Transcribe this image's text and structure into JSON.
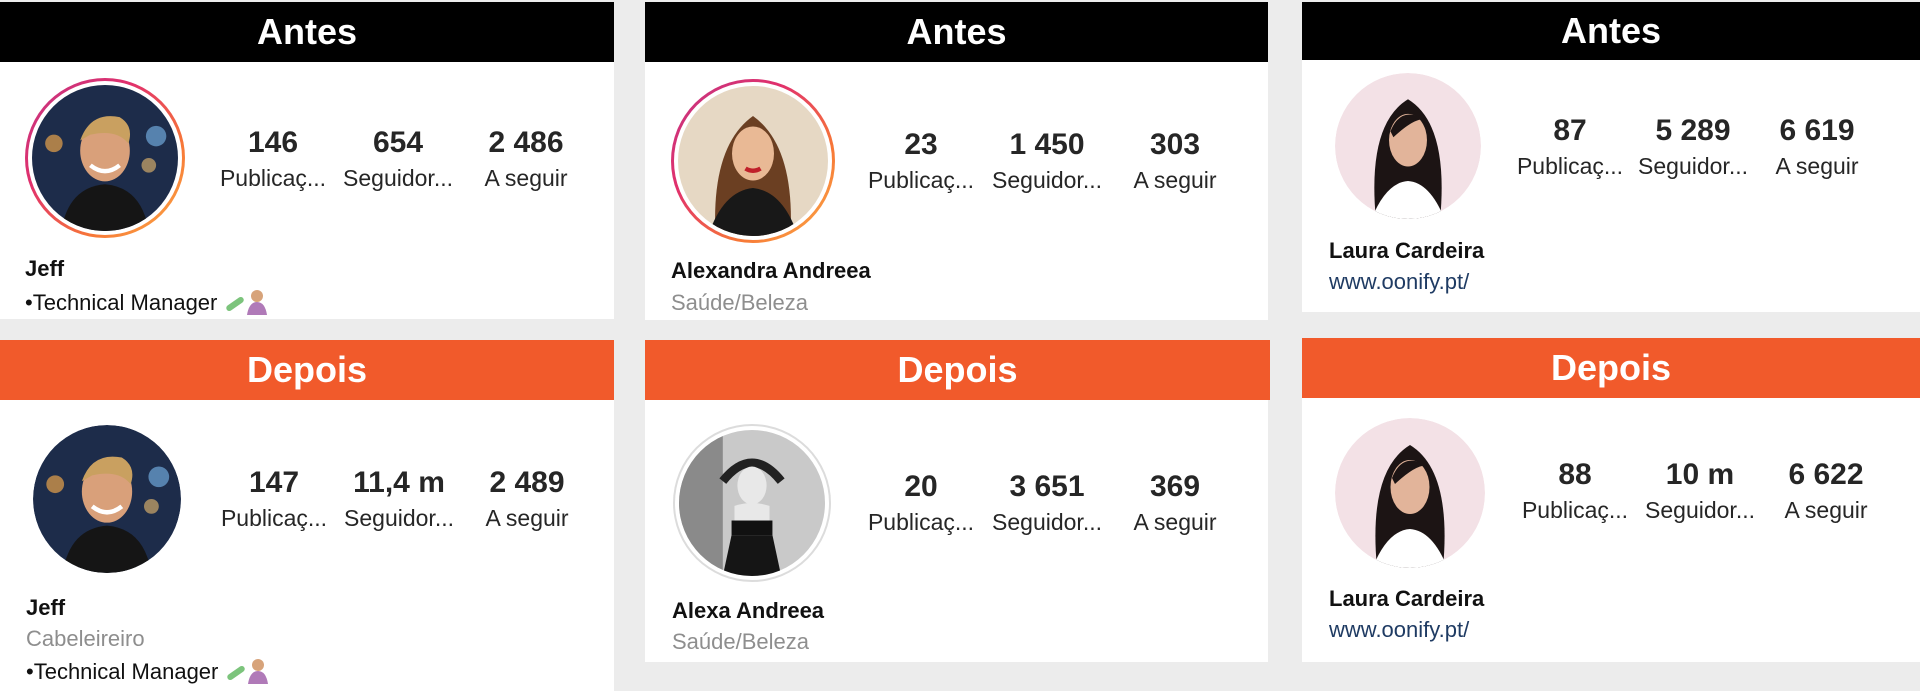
{
  "labels": {
    "before": "Antes",
    "after": "Depois"
  },
  "colors": {
    "before_banner": "#000000",
    "after_banner": "#f15a2b",
    "link": "#1f3b63"
  },
  "profiles": [
    {
      "before": {
        "stats": [
          {
            "value": "146",
            "label": "Publicaç..."
          },
          {
            "value": "654",
            "label": "Seguidor..."
          },
          {
            "value": "2 486",
            "label": "A seguir"
          }
        ],
        "name": "Jeff",
        "bio_line": "•Technical Manager"
      },
      "after": {
        "stats": [
          {
            "value": "147",
            "label": "Publicaç..."
          },
          {
            "value": "11,4 m",
            "label": "Seguidor..."
          },
          {
            "value": "2 489",
            "label": "A seguir"
          }
        ],
        "name": "Jeff",
        "category": "Cabeleireiro",
        "bio_line": "•Technical Manager"
      }
    },
    {
      "before": {
        "stats": [
          {
            "value": "23",
            "label": "Publicaç..."
          },
          {
            "value": "1 450",
            "label": "Seguidor..."
          },
          {
            "value": "303",
            "label": "A seguir"
          }
        ],
        "name": "Alexandra Andreea",
        "category": "Saúde/Beleza"
      },
      "after": {
        "stats": [
          {
            "value": "20",
            "label": "Publicaç..."
          },
          {
            "value": "3 651",
            "label": "Seguidor..."
          },
          {
            "value": "369",
            "label": "A seguir"
          }
        ],
        "name": "Alexa Andreea",
        "category": "Saúde/Beleza"
      }
    },
    {
      "before": {
        "stats": [
          {
            "value": "87",
            "label": "Publicaç..."
          },
          {
            "value": "5 289",
            "label": "Seguidor..."
          },
          {
            "value": "6 619",
            "label": "A seguir"
          }
        ],
        "name": "Laura Cardeira",
        "website": "www.oonify.pt/"
      },
      "after": {
        "stats": [
          {
            "value": "88",
            "label": "Publicaç..."
          },
          {
            "value": "10 m",
            "label": "Seguidor..."
          },
          {
            "value": "6 622",
            "label": "A seguir"
          }
        ],
        "name": "Laura Cardeira",
        "website": "www.oonify.pt/"
      }
    }
  ]
}
